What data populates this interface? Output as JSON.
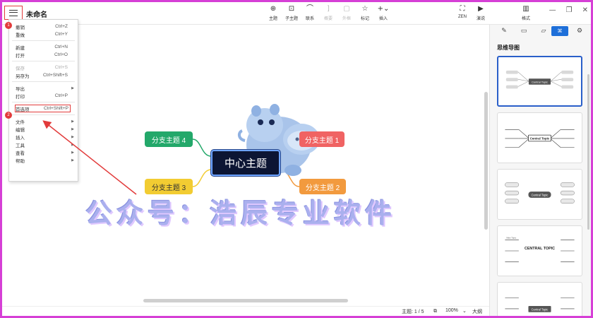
{
  "app": {
    "doc_title": "未命名",
    "menu_icon": "hamburger-menu-icon"
  },
  "toolbar": {
    "left": [
      {
        "label": "主题",
        "icon": "topic-icon",
        "glyph": "⊕",
        "enabled": true
      },
      {
        "label": "子主题",
        "icon": "subtopic-icon",
        "glyph": "⊡",
        "enabled": true
      },
      {
        "label": "联系",
        "icon": "relationship-icon",
        "glyph": "⌒",
        "enabled": true
      },
      {
        "label": "概要",
        "icon": "summary-icon",
        "glyph": "]",
        "enabled": false
      },
      {
        "label": "外框",
        "icon": "boundary-icon",
        "glyph": "▢",
        "enabled": false
      },
      {
        "label": "标记",
        "icon": "marker-star-icon",
        "glyph": "☆",
        "enabled": true
      },
      {
        "label": "插入",
        "icon": "insert-plus-icon",
        "glyph": "+⌄",
        "enabled": true
      }
    ],
    "right": [
      {
        "label": "ZEN",
        "icon": "zen-fullscreen-icon",
        "glyph": "⛶"
      },
      {
        "label": "演说",
        "icon": "pitch-play-icon",
        "glyph": "▶"
      },
      {
        "label": "格式",
        "icon": "format-panel-icon",
        "glyph": "▥"
      }
    ],
    "window_controls": [
      "—",
      "❐",
      "✕"
    ]
  },
  "menu": {
    "groups": [
      [
        {
          "label": "撤销",
          "shortcut": "Ctrl+Z"
        },
        {
          "label": "重做",
          "shortcut": "Ctrl+Y"
        }
      ],
      [
        {
          "label": "新建",
          "shortcut": "Ctrl+N"
        },
        {
          "label": "打开",
          "shortcut": "Ctrl+O"
        }
      ],
      [
        {
          "label": "保存",
          "shortcut": "Ctrl+S",
          "disabled": true
        },
        {
          "label": "另存为",
          "shortcut": "Ctrl+Shift+S"
        }
      ],
      [
        {
          "label": "导出",
          "submenu": true
        },
        {
          "label": "打印",
          "shortcut": "Ctrl+P"
        }
      ],
      [
        {
          "label": "首选项",
          "shortcut": "Ctrl+Shift+P",
          "highlighted": true
        }
      ],
      [
        {
          "label": "文件",
          "submenu": true
        },
        {
          "label": "编辑",
          "submenu": true
        },
        {
          "label": "插入",
          "submenu": true
        },
        {
          "label": "工具",
          "submenu": true
        },
        {
          "label": "查看",
          "submenu": true
        },
        {
          "label": "帮助",
          "submenu": true
        }
      ]
    ],
    "steps": [
      "1",
      "2"
    ]
  },
  "mindmap": {
    "central": "中心主题",
    "branches": [
      "分支主题 1",
      "分支主题 2",
      "分支主题 3",
      "分支主题 4"
    ]
  },
  "watermark": "公众号：浩辰专业软件",
  "status": {
    "topic_count": "主题: 1 / 5",
    "zoom": "100%",
    "outline": "大纲"
  },
  "panel": {
    "tabs": [
      "✎",
      "▭",
      "▱",
      "⌘",
      "⚙"
    ],
    "section_title": "思维导图",
    "theme_labels": {
      "central_topic": "Central Topic",
      "central_topic_caps": "CENTRAL TOPIC",
      "main_topic": "Main Topic"
    }
  },
  "colors": {
    "accent": "#1e6fd9",
    "central_bg": "#0c1533",
    "branch1": "#f06363",
    "branch2": "#f29a3e",
    "branch3": "#f2cc32",
    "branch4": "#23a86a",
    "annotation_red": "#e23b3b",
    "frame": "#d63fd6"
  }
}
